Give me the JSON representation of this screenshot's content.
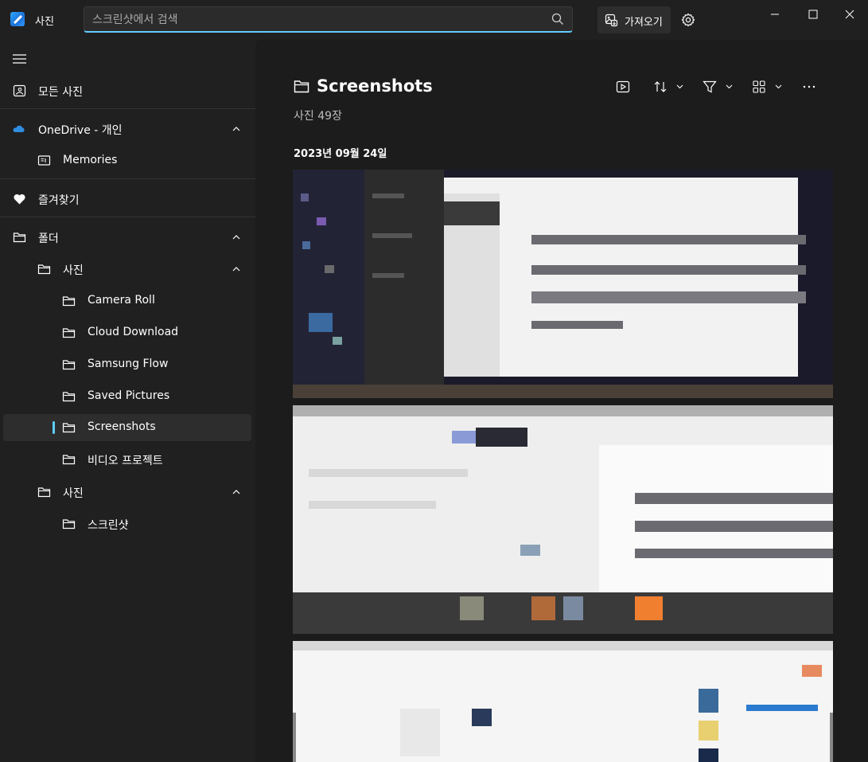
{
  "app": {
    "title": "사진"
  },
  "search": {
    "placeholder": "스크린샷에서 검색",
    "value": ""
  },
  "header": {
    "import_label": "가져오기"
  },
  "sidebar": {
    "all_photos": "모든 사진",
    "onedrive": "OneDrive - 개인",
    "memories": "Memories",
    "favorites": "즐겨찾기",
    "folders": "폴더",
    "pictures_1": "사진",
    "sub_folders": [
      "Camera Roll",
      "Cloud Download",
      "Samsung Flow",
      "Saved Pictures",
      "Screenshots",
      "비디오 프로젝트"
    ],
    "pictures_2": "사진",
    "screenshots_ko": "스크린샷",
    "selected": "Screenshots"
  },
  "main": {
    "folder_title": "Screenshots",
    "photo_count": "사진 49장",
    "date_group": "2023년 09월 24일",
    "toolbar_icons": [
      "slideshow-icon",
      "sort-icon",
      "filter-icon",
      "view-icon",
      "more-icon"
    ]
  },
  "colors": {
    "accent": "#60cdff",
    "background": "#1c1c1c",
    "sidebar": "#202020"
  }
}
